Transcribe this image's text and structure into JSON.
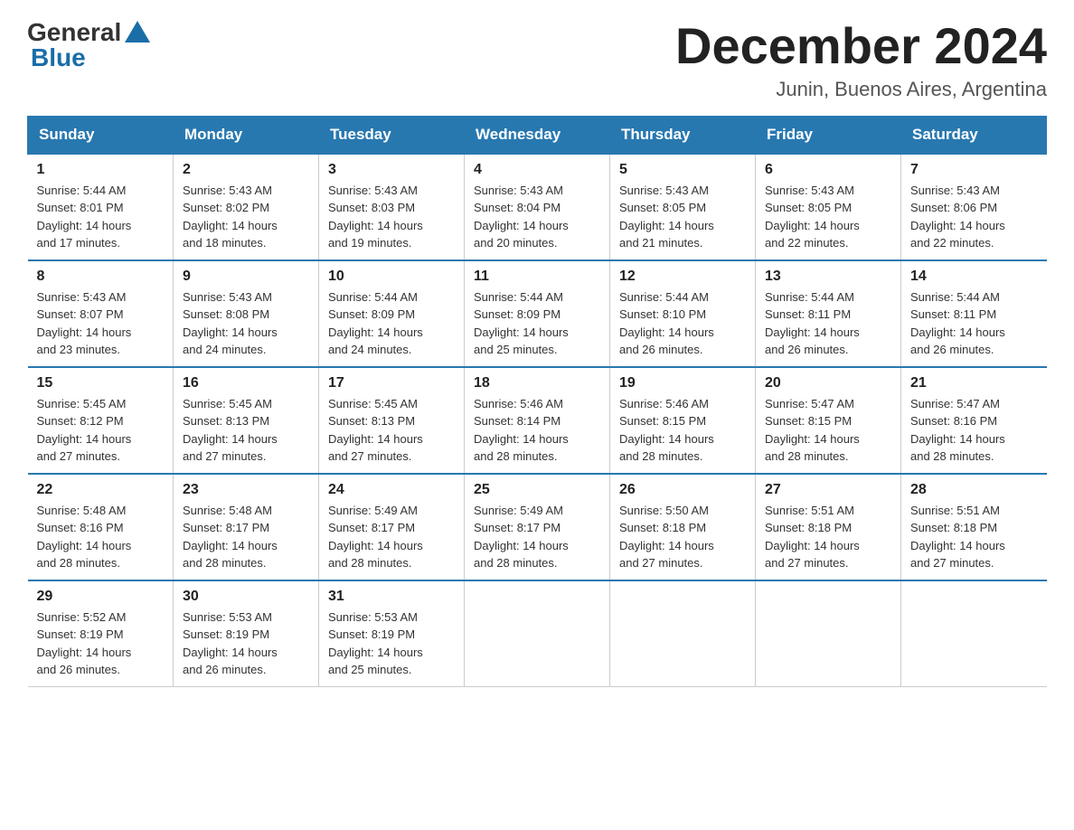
{
  "logo": {
    "general": "General",
    "blue": "Blue"
  },
  "title": "December 2024",
  "subtitle": "Junin, Buenos Aires, Argentina",
  "headers": [
    "Sunday",
    "Monday",
    "Tuesday",
    "Wednesday",
    "Thursday",
    "Friday",
    "Saturday"
  ],
  "weeks": [
    [
      {
        "day": "1",
        "sunrise": "5:44 AM",
        "sunset": "8:01 PM",
        "daylight": "14 hours and 17 minutes."
      },
      {
        "day": "2",
        "sunrise": "5:43 AM",
        "sunset": "8:02 PM",
        "daylight": "14 hours and 18 minutes."
      },
      {
        "day": "3",
        "sunrise": "5:43 AM",
        "sunset": "8:03 PM",
        "daylight": "14 hours and 19 minutes."
      },
      {
        "day": "4",
        "sunrise": "5:43 AM",
        "sunset": "8:04 PM",
        "daylight": "14 hours and 20 minutes."
      },
      {
        "day": "5",
        "sunrise": "5:43 AM",
        "sunset": "8:05 PM",
        "daylight": "14 hours and 21 minutes."
      },
      {
        "day": "6",
        "sunrise": "5:43 AM",
        "sunset": "8:05 PM",
        "daylight": "14 hours and 22 minutes."
      },
      {
        "day": "7",
        "sunrise": "5:43 AM",
        "sunset": "8:06 PM",
        "daylight": "14 hours and 22 minutes."
      }
    ],
    [
      {
        "day": "8",
        "sunrise": "5:43 AM",
        "sunset": "8:07 PM",
        "daylight": "14 hours and 23 minutes."
      },
      {
        "day": "9",
        "sunrise": "5:43 AM",
        "sunset": "8:08 PM",
        "daylight": "14 hours and 24 minutes."
      },
      {
        "day": "10",
        "sunrise": "5:44 AM",
        "sunset": "8:09 PM",
        "daylight": "14 hours and 24 minutes."
      },
      {
        "day": "11",
        "sunrise": "5:44 AM",
        "sunset": "8:09 PM",
        "daylight": "14 hours and 25 minutes."
      },
      {
        "day": "12",
        "sunrise": "5:44 AM",
        "sunset": "8:10 PM",
        "daylight": "14 hours and 26 minutes."
      },
      {
        "day": "13",
        "sunrise": "5:44 AM",
        "sunset": "8:11 PM",
        "daylight": "14 hours and 26 minutes."
      },
      {
        "day": "14",
        "sunrise": "5:44 AM",
        "sunset": "8:11 PM",
        "daylight": "14 hours and 26 minutes."
      }
    ],
    [
      {
        "day": "15",
        "sunrise": "5:45 AM",
        "sunset": "8:12 PM",
        "daylight": "14 hours and 27 minutes."
      },
      {
        "day": "16",
        "sunrise": "5:45 AM",
        "sunset": "8:13 PM",
        "daylight": "14 hours and 27 minutes."
      },
      {
        "day": "17",
        "sunrise": "5:45 AM",
        "sunset": "8:13 PM",
        "daylight": "14 hours and 27 minutes."
      },
      {
        "day": "18",
        "sunrise": "5:46 AM",
        "sunset": "8:14 PM",
        "daylight": "14 hours and 28 minutes."
      },
      {
        "day": "19",
        "sunrise": "5:46 AM",
        "sunset": "8:15 PM",
        "daylight": "14 hours and 28 minutes."
      },
      {
        "day": "20",
        "sunrise": "5:47 AM",
        "sunset": "8:15 PM",
        "daylight": "14 hours and 28 minutes."
      },
      {
        "day": "21",
        "sunrise": "5:47 AM",
        "sunset": "8:16 PM",
        "daylight": "14 hours and 28 minutes."
      }
    ],
    [
      {
        "day": "22",
        "sunrise": "5:48 AM",
        "sunset": "8:16 PM",
        "daylight": "14 hours and 28 minutes."
      },
      {
        "day": "23",
        "sunrise": "5:48 AM",
        "sunset": "8:17 PM",
        "daylight": "14 hours and 28 minutes."
      },
      {
        "day": "24",
        "sunrise": "5:49 AM",
        "sunset": "8:17 PM",
        "daylight": "14 hours and 28 minutes."
      },
      {
        "day": "25",
        "sunrise": "5:49 AM",
        "sunset": "8:17 PM",
        "daylight": "14 hours and 28 minutes."
      },
      {
        "day": "26",
        "sunrise": "5:50 AM",
        "sunset": "8:18 PM",
        "daylight": "14 hours and 27 minutes."
      },
      {
        "day": "27",
        "sunrise": "5:51 AM",
        "sunset": "8:18 PM",
        "daylight": "14 hours and 27 minutes."
      },
      {
        "day": "28",
        "sunrise": "5:51 AM",
        "sunset": "8:18 PM",
        "daylight": "14 hours and 27 minutes."
      }
    ],
    [
      {
        "day": "29",
        "sunrise": "5:52 AM",
        "sunset": "8:19 PM",
        "daylight": "14 hours and 26 minutes."
      },
      {
        "day": "30",
        "sunrise": "5:53 AM",
        "sunset": "8:19 PM",
        "daylight": "14 hours and 26 minutes."
      },
      {
        "day": "31",
        "sunrise": "5:53 AM",
        "sunset": "8:19 PM",
        "daylight": "14 hours and 25 minutes."
      },
      null,
      null,
      null,
      null
    ]
  ],
  "labels": {
    "sunrise": "Sunrise:",
    "sunset": "Sunset:",
    "daylight": "Daylight:"
  }
}
